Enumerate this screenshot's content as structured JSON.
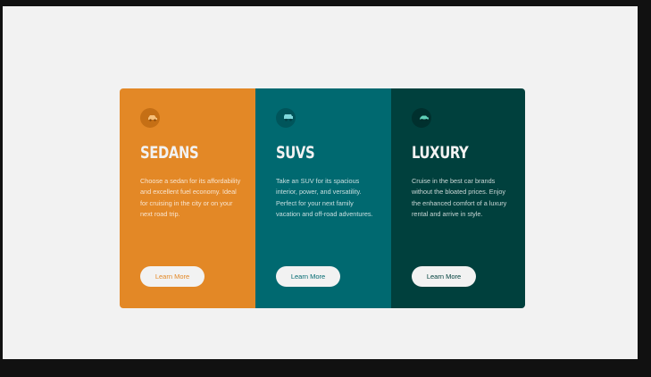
{
  "colors": {
    "page_background": "#f2f2f2",
    "frame": "#111111",
    "sedans": "#e38826",
    "suvs": "#006970",
    "luxury": "#00403d",
    "button": "#f2f2f2"
  },
  "cards": [
    {
      "title": "SEDANS",
      "icon": "sedan-car-icon",
      "text": "Choose a sedan for its affordability and excellent fuel economy. Ideal for cruising in the city or on your next road trip.",
      "button_label": "Learn More"
    },
    {
      "title": "SUVS",
      "icon": "suv-car-icon",
      "text": "Take an SUV for its spacious interior, power, and versatility. Perfect for your next family vacation and off-road adventures.",
      "button_label": "Learn More"
    },
    {
      "title": "LUXURY",
      "icon": "luxury-car-icon",
      "text": "Cruise in the best car brands without the bloated prices. Enjoy the enhanced comfort of a luxury rental and arrive in style.",
      "button_label": "Learn More"
    }
  ]
}
